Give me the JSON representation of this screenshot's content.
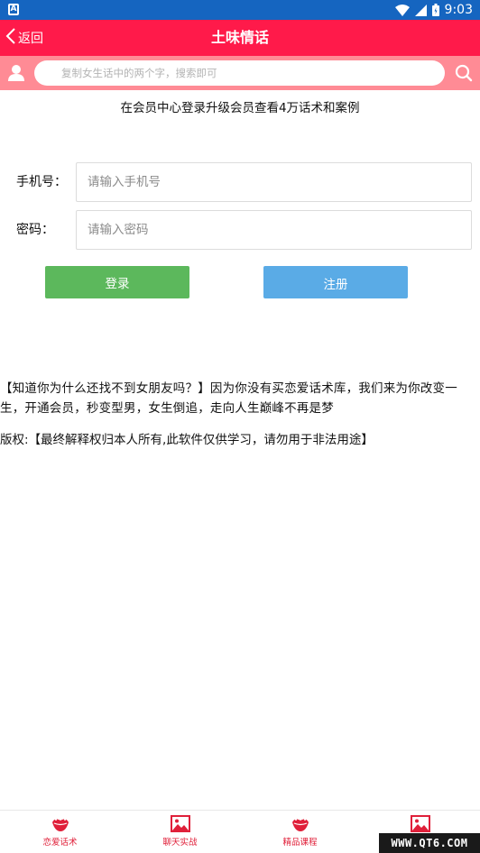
{
  "status_bar": {
    "time": "9:03",
    "colors": {
      "background": "#1565c0"
    },
    "icons": [
      "app-a-icon",
      "wifi-icon",
      "signal-icon",
      "battery-icon"
    ]
  },
  "header": {
    "back_label": "返回",
    "title": "土味情话",
    "colors": {
      "background": "#ff1a4a"
    }
  },
  "search": {
    "placeholder": "复制女生话中的两个字，搜索即可",
    "colors": {
      "background": "#ff8b95"
    }
  },
  "notice": "在会员中心登录升级会员查看4万话术和案例",
  "login_form": {
    "phone_label": "手机号：",
    "phone_placeholder": "请输入手机号",
    "password_label": "密码：",
    "password_placeholder": "请输入密码",
    "login_button": "登录",
    "register_button": "注册",
    "colors": {
      "login": "#5cb85c",
      "register": "#5aabe6"
    }
  },
  "promo_text": "【知道你为什么还找不到女朋友吗？】因为你没有买恋爱话术库，我们来为你改变一生，开通会员，秒变型男，女生倒追，走向人生巅峰不再是梦",
  "copyright_text": "版权:【最终解释权归本人所有,此软件仅供学习，请勿用于非法用途】",
  "bottom_nav": {
    "items": [
      {
        "label": "恋爱话术",
        "icon": "lips-icon"
      },
      {
        "label": "聊天实战",
        "icon": "image-icon"
      },
      {
        "label": "精品课程",
        "icon": "lips-icon"
      },
      {
        "label": "",
        "icon": "image-icon"
      }
    ],
    "colors": {
      "accent": "#e0203a"
    }
  },
  "watermark": "WWW.QT6.COM"
}
